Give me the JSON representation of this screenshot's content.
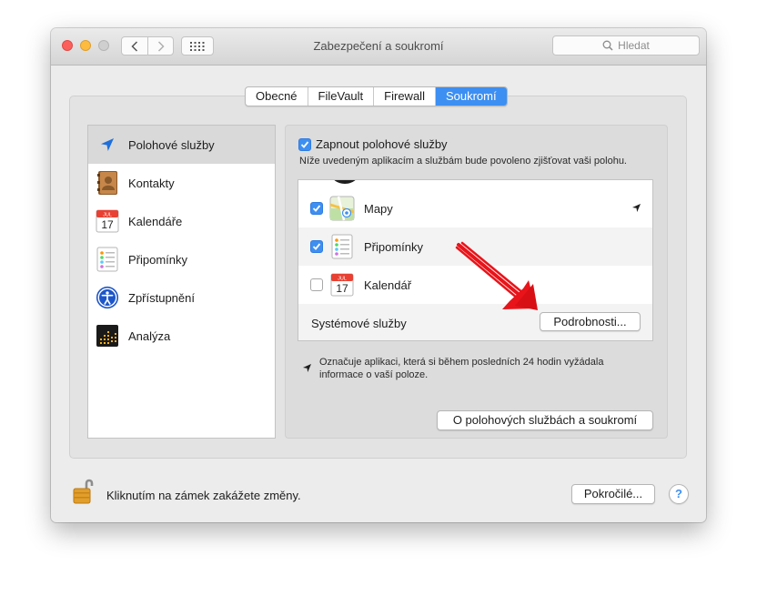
{
  "window": {
    "title": "Zabezpečení a soukromí",
    "search_placeholder": "Hledat"
  },
  "tabs": [
    {
      "label": "Obecné",
      "active": false
    },
    {
      "label": "FileVault",
      "active": false
    },
    {
      "label": "Firewall",
      "active": false
    },
    {
      "label": "Soukromí",
      "active": true
    }
  ],
  "sidebar": {
    "items": [
      {
        "label": "Polohové služby",
        "icon": "location-arrow-icon",
        "selected": true
      },
      {
        "label": "Kontakty",
        "icon": "contacts-book-icon",
        "selected": false
      },
      {
        "label": "Kalendáře",
        "icon": "calendar-icon",
        "selected": false
      },
      {
        "label": "Připomínky",
        "icon": "reminders-icon",
        "selected": false
      },
      {
        "label": "Zpřístupnění",
        "icon": "accessibility-icon",
        "selected": false
      },
      {
        "label": "Analýza",
        "icon": "analytics-icon",
        "selected": false
      }
    ]
  },
  "location": {
    "enable_label": "Zapnout polohové služby",
    "enable_checked": true,
    "description": "Níže uvedeným aplikacím a službám bude povoleno zjišťovat vaši polohu.",
    "apps": [
      {
        "name": "Mapy",
        "checked": true,
        "icon": "maps-icon",
        "recent_location": true
      },
      {
        "name": "Připomínky",
        "checked": true,
        "icon": "reminders-icon",
        "recent_location": false
      },
      {
        "name": "Kalendář",
        "checked": false,
        "icon": "calendar-icon",
        "recent_location": false
      }
    ],
    "calendar_month": "JUL",
    "calendar_day": "17",
    "system_services_label": "Systémové služby",
    "details_button": "Podrobnosti...",
    "legend_text": "Označuje aplikaci, která si během posledních 24 hodin vyžádala informace o vaší poloze.",
    "about_button": "O polohových službách a soukromí"
  },
  "footer": {
    "lock_text": "Kliknutím na zámek zakážete změny.",
    "advanced_button": "Pokročilé...",
    "help_button": "?"
  },
  "colors": {
    "accent": "#3d8ff2",
    "annotation_arrow": "#e8141a"
  }
}
